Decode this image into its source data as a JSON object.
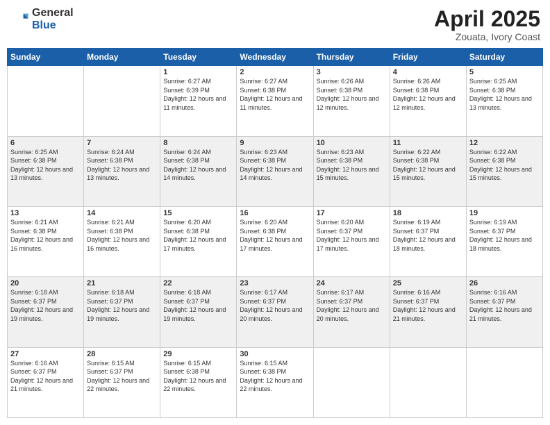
{
  "logo": {
    "general": "General",
    "blue": "Blue"
  },
  "title": "April 2025",
  "location": "Zouata, Ivory Coast",
  "days_header": [
    "Sunday",
    "Monday",
    "Tuesday",
    "Wednesday",
    "Thursday",
    "Friday",
    "Saturday"
  ],
  "weeks": [
    [
      {
        "day": "",
        "info": ""
      },
      {
        "day": "",
        "info": ""
      },
      {
        "day": "1",
        "info": "Sunrise: 6:27 AM\nSunset: 6:39 PM\nDaylight: 12 hours and 11 minutes."
      },
      {
        "day": "2",
        "info": "Sunrise: 6:27 AM\nSunset: 6:38 PM\nDaylight: 12 hours and 11 minutes."
      },
      {
        "day": "3",
        "info": "Sunrise: 6:26 AM\nSunset: 6:38 PM\nDaylight: 12 hours and 12 minutes."
      },
      {
        "day": "4",
        "info": "Sunrise: 6:26 AM\nSunset: 6:38 PM\nDaylight: 12 hours and 12 minutes."
      },
      {
        "day": "5",
        "info": "Sunrise: 6:25 AM\nSunset: 6:38 PM\nDaylight: 12 hours and 13 minutes."
      }
    ],
    [
      {
        "day": "6",
        "info": "Sunrise: 6:25 AM\nSunset: 6:38 PM\nDaylight: 12 hours and 13 minutes."
      },
      {
        "day": "7",
        "info": "Sunrise: 6:24 AM\nSunset: 6:38 PM\nDaylight: 12 hours and 13 minutes."
      },
      {
        "day": "8",
        "info": "Sunrise: 6:24 AM\nSunset: 6:38 PM\nDaylight: 12 hours and 14 minutes."
      },
      {
        "day": "9",
        "info": "Sunrise: 6:23 AM\nSunset: 6:38 PM\nDaylight: 12 hours and 14 minutes."
      },
      {
        "day": "10",
        "info": "Sunrise: 6:23 AM\nSunset: 6:38 PM\nDaylight: 12 hours and 15 minutes."
      },
      {
        "day": "11",
        "info": "Sunrise: 6:22 AM\nSunset: 6:38 PM\nDaylight: 12 hours and 15 minutes."
      },
      {
        "day": "12",
        "info": "Sunrise: 6:22 AM\nSunset: 6:38 PM\nDaylight: 12 hours and 15 minutes."
      }
    ],
    [
      {
        "day": "13",
        "info": "Sunrise: 6:21 AM\nSunset: 6:38 PM\nDaylight: 12 hours and 16 minutes."
      },
      {
        "day": "14",
        "info": "Sunrise: 6:21 AM\nSunset: 6:38 PM\nDaylight: 12 hours and 16 minutes."
      },
      {
        "day": "15",
        "info": "Sunrise: 6:20 AM\nSunset: 6:38 PM\nDaylight: 12 hours and 17 minutes."
      },
      {
        "day": "16",
        "info": "Sunrise: 6:20 AM\nSunset: 6:38 PM\nDaylight: 12 hours and 17 minutes."
      },
      {
        "day": "17",
        "info": "Sunrise: 6:20 AM\nSunset: 6:37 PM\nDaylight: 12 hours and 17 minutes."
      },
      {
        "day": "18",
        "info": "Sunrise: 6:19 AM\nSunset: 6:37 PM\nDaylight: 12 hours and 18 minutes."
      },
      {
        "day": "19",
        "info": "Sunrise: 6:19 AM\nSunset: 6:37 PM\nDaylight: 12 hours and 18 minutes."
      }
    ],
    [
      {
        "day": "20",
        "info": "Sunrise: 6:18 AM\nSunset: 6:37 PM\nDaylight: 12 hours and 19 minutes."
      },
      {
        "day": "21",
        "info": "Sunrise: 6:18 AM\nSunset: 6:37 PM\nDaylight: 12 hours and 19 minutes."
      },
      {
        "day": "22",
        "info": "Sunrise: 6:18 AM\nSunset: 6:37 PM\nDaylight: 12 hours and 19 minutes."
      },
      {
        "day": "23",
        "info": "Sunrise: 6:17 AM\nSunset: 6:37 PM\nDaylight: 12 hours and 20 minutes."
      },
      {
        "day": "24",
        "info": "Sunrise: 6:17 AM\nSunset: 6:37 PM\nDaylight: 12 hours and 20 minutes."
      },
      {
        "day": "25",
        "info": "Sunrise: 6:16 AM\nSunset: 6:37 PM\nDaylight: 12 hours and 21 minutes."
      },
      {
        "day": "26",
        "info": "Sunrise: 6:16 AM\nSunset: 6:37 PM\nDaylight: 12 hours and 21 minutes."
      }
    ],
    [
      {
        "day": "27",
        "info": "Sunrise: 6:16 AM\nSunset: 6:37 PM\nDaylight: 12 hours and 21 minutes."
      },
      {
        "day": "28",
        "info": "Sunrise: 6:15 AM\nSunset: 6:37 PM\nDaylight: 12 hours and 22 minutes."
      },
      {
        "day": "29",
        "info": "Sunrise: 6:15 AM\nSunset: 6:38 PM\nDaylight: 12 hours and 22 minutes."
      },
      {
        "day": "30",
        "info": "Sunrise: 6:15 AM\nSunset: 6:38 PM\nDaylight: 12 hours and 22 minutes."
      },
      {
        "day": "",
        "info": ""
      },
      {
        "day": "",
        "info": ""
      },
      {
        "day": "",
        "info": ""
      }
    ]
  ]
}
